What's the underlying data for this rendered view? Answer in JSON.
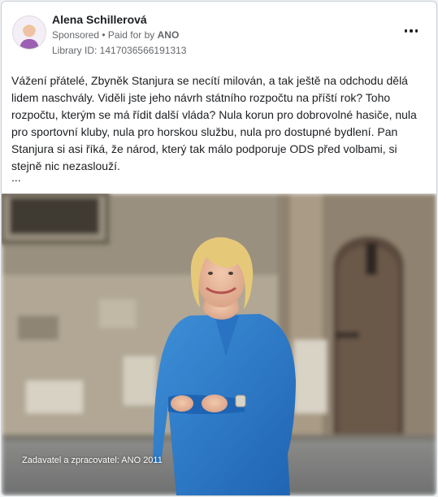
{
  "post": {
    "page_name": "Alena Schillerová",
    "sponsored_label": "Sponsored",
    "paid_for_label": "• Paid for by",
    "payer": "ANO",
    "library_id": "Library ID: 1417036566191313",
    "text": "Vážení přátelé, Zbyněk Stanjura se necítí milován, a tak ještě na odchodu dělá lidem naschvály. Viděli jste jeho návrh státního rozpočtu na příští rok? Toho rozpočtu, kterým se má řídit další vláda? Nula korun pro dobrovolné hasiče, nula pro sportovní kluby, nula pro horskou službu, nula pro dostupné bydlení. Pan Stanjura si asi říká, že národ, který tak málo podporuje ODS před volbami, si stejně nic nezaslouží.",
    "see_more": "...",
    "image_caption": "Zadavatel a zpracovatel: ANO 2011",
    "more_icon": "more-options-icon"
  }
}
